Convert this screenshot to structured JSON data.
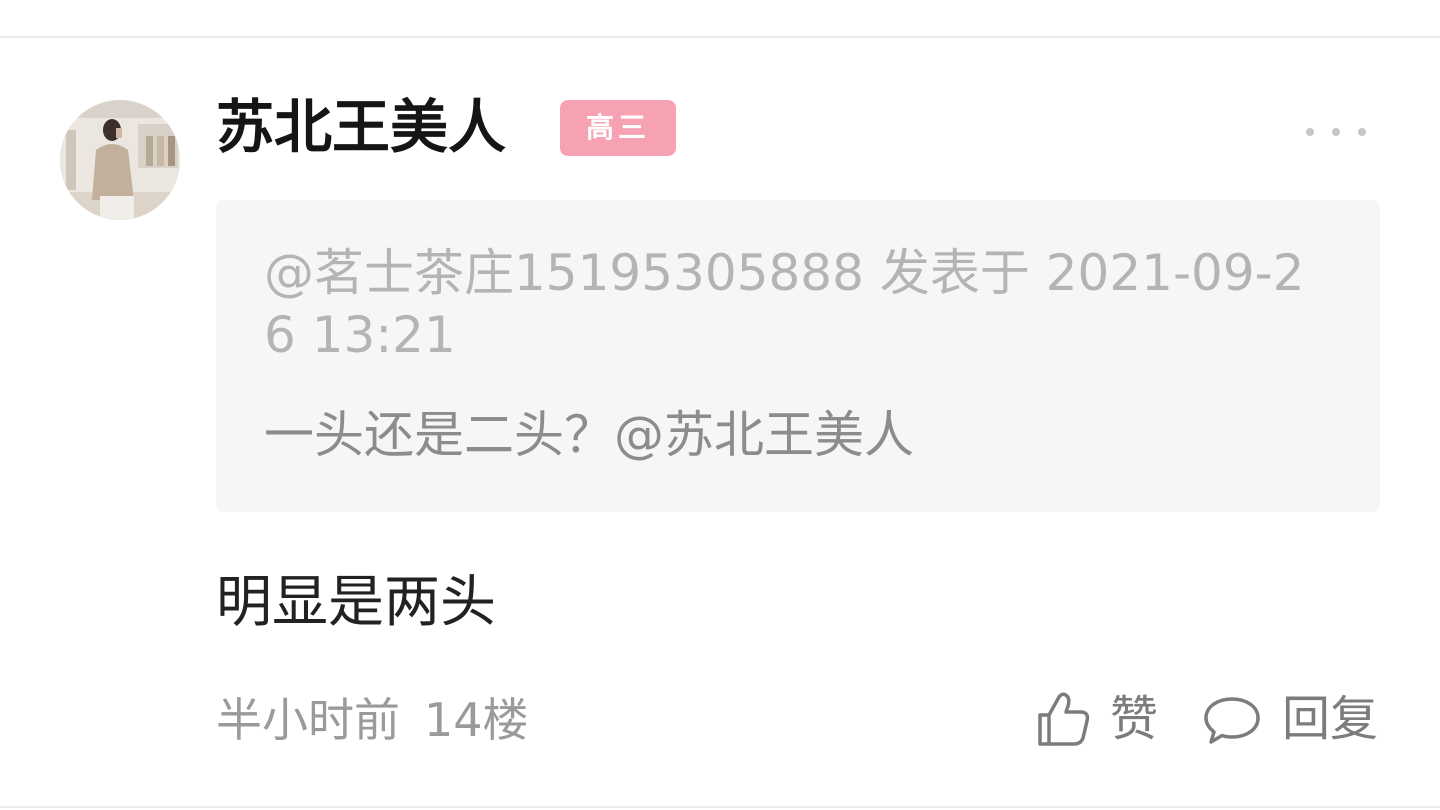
{
  "post": {
    "username": "苏北王美人",
    "grade_badge": "高三",
    "more_icon": "more-horizontal-icon",
    "quote": {
      "meta": "@茗士茶庄15195305888 发表于 2021-09-26 13:21",
      "text": "一头还是二头？@苏北王美人"
    },
    "reply_text": "明显是两头",
    "time_ago": "半小时前",
    "floor": "14楼",
    "like_label": "赞",
    "reply_label": "回复"
  },
  "colors": {
    "badge": "#f7a2b3",
    "quote_bg": "#f6f6f6",
    "meta_text": "#9a9a9a"
  }
}
